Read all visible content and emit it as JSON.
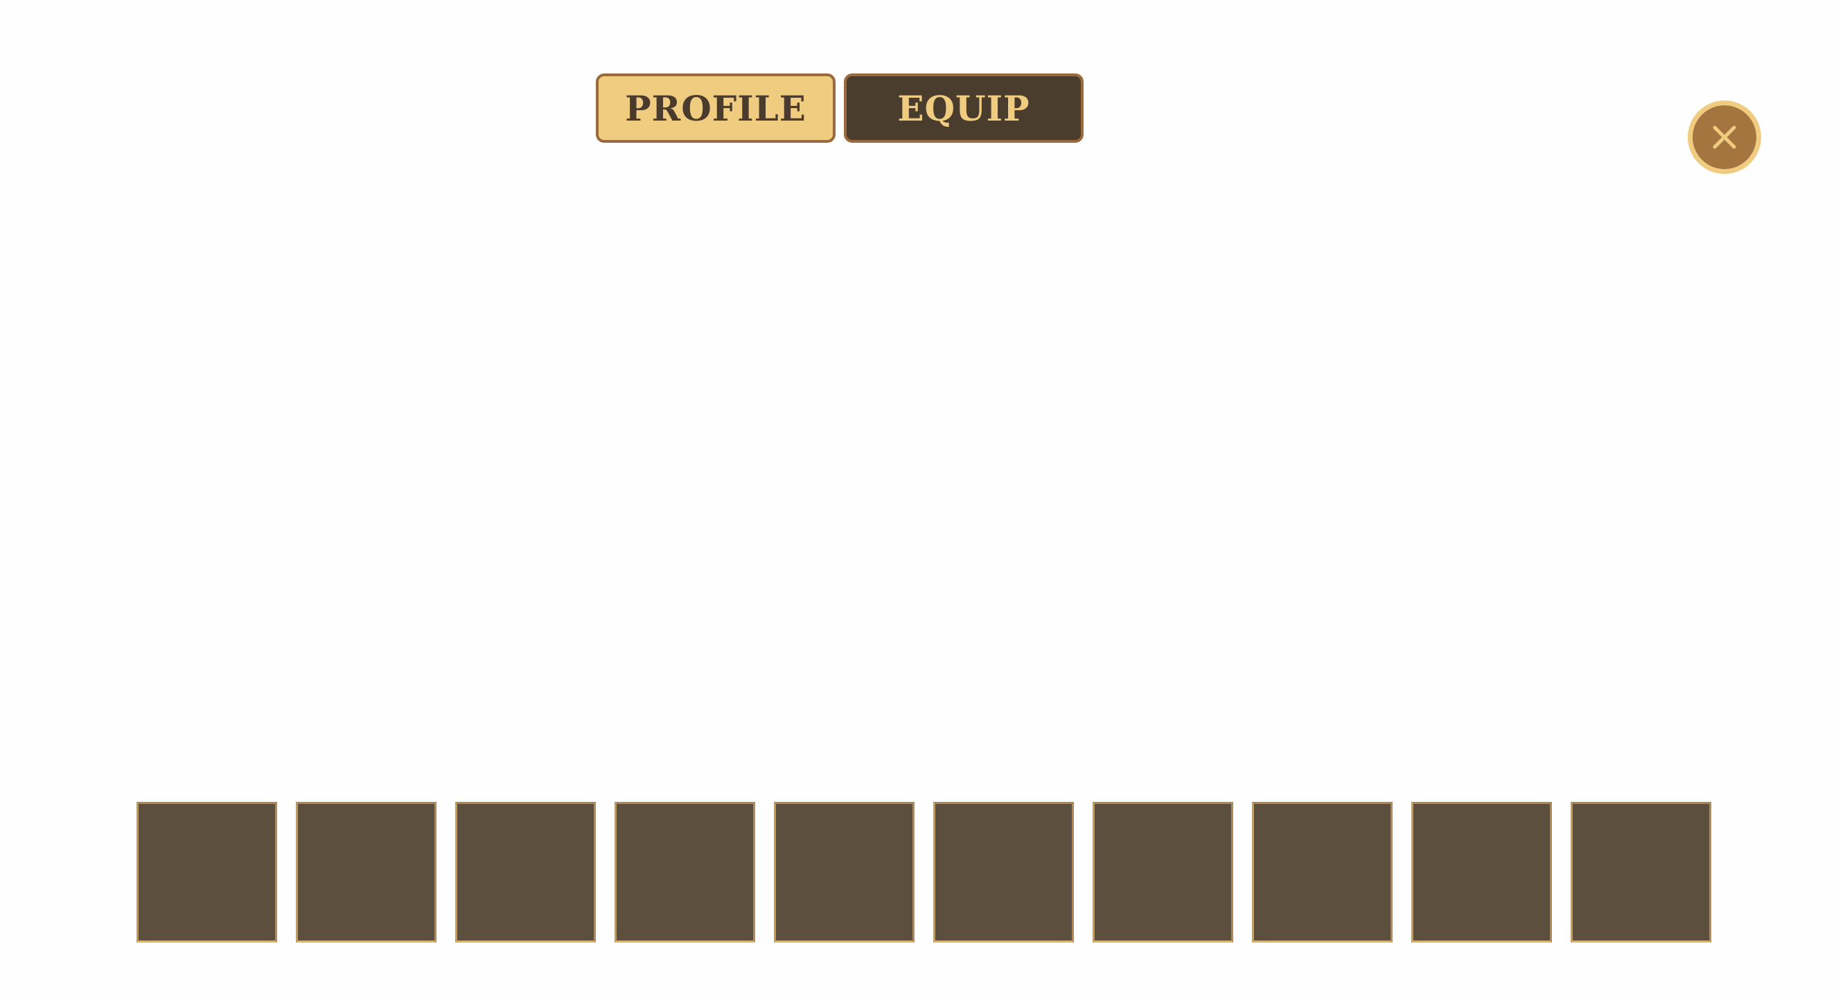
{
  "tabs": [
    {
      "label": "PROFILE",
      "active": false
    },
    {
      "label": "EQUIP",
      "active": true
    }
  ],
  "close_button": {
    "icon": "close-icon"
  },
  "equipment_slots": {
    "count": 10,
    "items": [
      "",
      "",
      "",
      "",
      "",
      "",
      "",
      "",
      "",
      ""
    ]
  },
  "colors": {
    "background": "#fefefe",
    "tab_inactive_bg": "#f0cc80",
    "tab_active_bg": "#4a3d2d",
    "tab_border": "#9a6a3c",
    "close_bg": "#a57540",
    "close_ring": "#f0cc80",
    "slot_bg": "#5c4f3e",
    "slot_border": "#b08a52"
  }
}
